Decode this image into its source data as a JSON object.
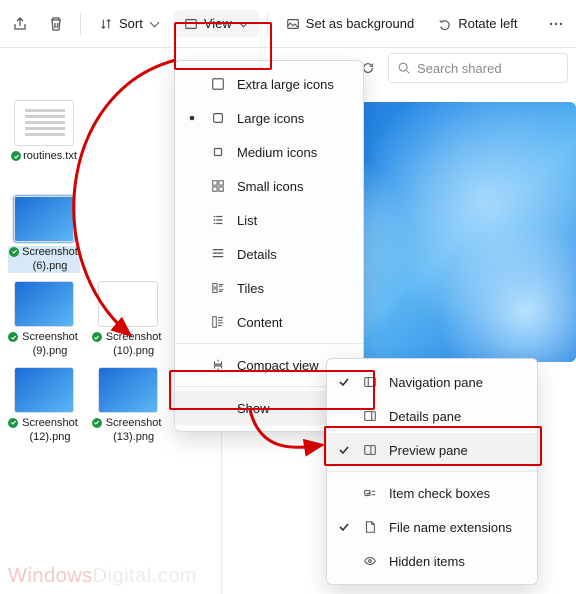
{
  "toolbar": {
    "sort_label": "Sort",
    "view_label": "View",
    "bg_label": "Set as background",
    "rotate_label": "Rotate left"
  },
  "subbar": {
    "search_placeholder": "Search shared"
  },
  "view_menu": {
    "items": [
      {
        "label": "Extra large icons",
        "selected": false
      },
      {
        "label": "Large icons",
        "selected": true
      },
      {
        "label": "Medium icons",
        "selected": false
      },
      {
        "label": "Small icons",
        "selected": false
      },
      {
        "label": "List",
        "selected": false
      },
      {
        "label": "Details",
        "selected": false
      },
      {
        "label": "Tiles",
        "selected": false
      },
      {
        "label": "Content",
        "selected": false
      },
      {
        "label": "Compact view",
        "selected": false
      }
    ],
    "show_label": "Show"
  },
  "show_submenu": {
    "items": [
      {
        "label": "Navigation pane",
        "checked": true
      },
      {
        "label": "Details pane",
        "checked": false
      },
      {
        "label": "Preview pane",
        "checked": true
      },
      {
        "label": "Item check boxes",
        "checked": false
      },
      {
        "label": "File name extensions",
        "checked": true
      },
      {
        "label": "Hidden items",
        "checked": false
      }
    ]
  },
  "files": [
    {
      "name": "routines.txt",
      "kind": "text"
    },
    {
      "name": "Screenshot (6).png",
      "kind": "img",
      "selected": true
    },
    {
      "name": "Screenshot (9).png",
      "kind": "img"
    },
    {
      "name": "Screenshot (10).png",
      "kind": "folder"
    },
    {
      "name": "Screenshot (12).png",
      "kind": "img"
    },
    {
      "name": "Screenshot (13).png",
      "kind": "img"
    }
  ],
  "watermark": {
    "a": "Windows",
    "b": "Digital.com"
  }
}
